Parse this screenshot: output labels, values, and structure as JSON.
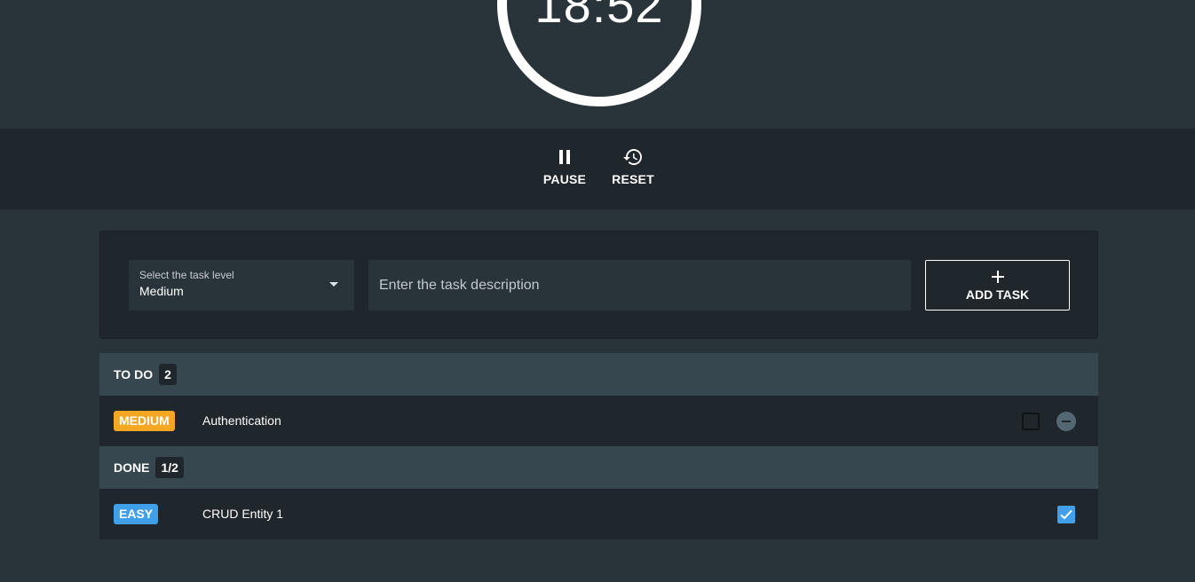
{
  "timer": {
    "time": "18:52",
    "ring_color": "#ffffff"
  },
  "controls": {
    "pause_label": "PAUSE",
    "pause_icon": "pause-icon",
    "reset_label": "RESET",
    "reset_icon": "history-icon"
  },
  "task_form": {
    "level_label": "Select the task level",
    "level_value": "Medium",
    "description_placeholder": "Enter the task description",
    "description_value": "",
    "add_button_label": "ADD TASK",
    "add_button_icon": "plus-icon"
  },
  "todo": {
    "title": "TO DO",
    "count": "2",
    "tasks": [
      {
        "level": "MEDIUM",
        "level_color": "#f5a623",
        "title": "Authentication",
        "done": false
      }
    ]
  },
  "done": {
    "title": "DONE",
    "count": "1/2",
    "tasks": [
      {
        "level": "EASY",
        "level_color": "#3f9fe8",
        "title": "CRUD Entity 1",
        "done": true
      }
    ]
  },
  "colors": {
    "background": "#29333a",
    "panel": "#1f262c",
    "section_header": "#37474f",
    "accent_blue": "#42a0ea",
    "accent_orange": "#f5a623"
  }
}
